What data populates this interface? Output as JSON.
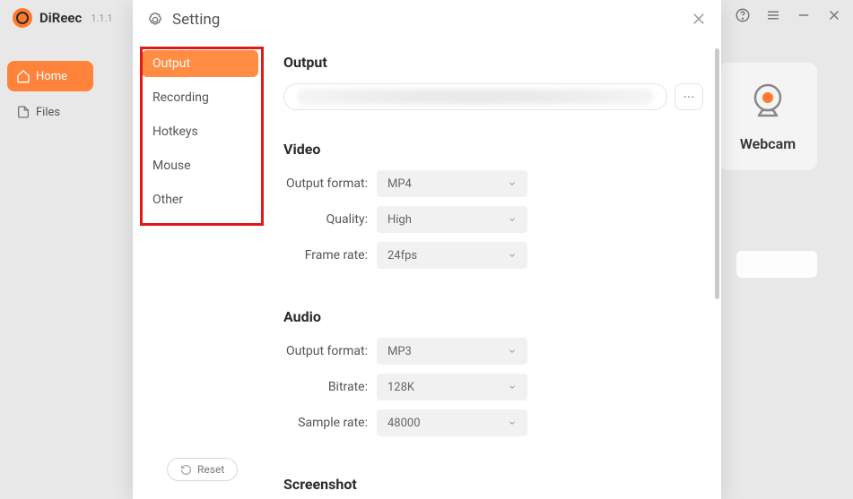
{
  "app": {
    "name": "DiReec",
    "version": "1.1.1"
  },
  "nav": {
    "home": "Home",
    "files": "Files"
  },
  "webcam_card": {
    "label": "Webcam"
  },
  "modal": {
    "title": "Setting",
    "tabs": {
      "output": "Output",
      "recording": "Recording",
      "hotkeys": "Hotkeys",
      "mouse": "Mouse",
      "other": "Other"
    },
    "reset": "Reset"
  },
  "settings": {
    "output_section": "Output",
    "video_section": "Video",
    "audio_section": "Audio",
    "screenshot_section": "Screenshot",
    "labels": {
      "output_format": "Output format:",
      "quality": "Quality:",
      "frame_rate": "Frame rate:",
      "bitrate": "Bitrate:",
      "sample_rate": "Sample rate:"
    },
    "video": {
      "output_format": "MP4",
      "quality": "High",
      "frame_rate": "24fps"
    },
    "audio": {
      "output_format": "MP3",
      "bitrate": "128K",
      "sample_rate": "48000"
    },
    "path_browse": "···"
  }
}
